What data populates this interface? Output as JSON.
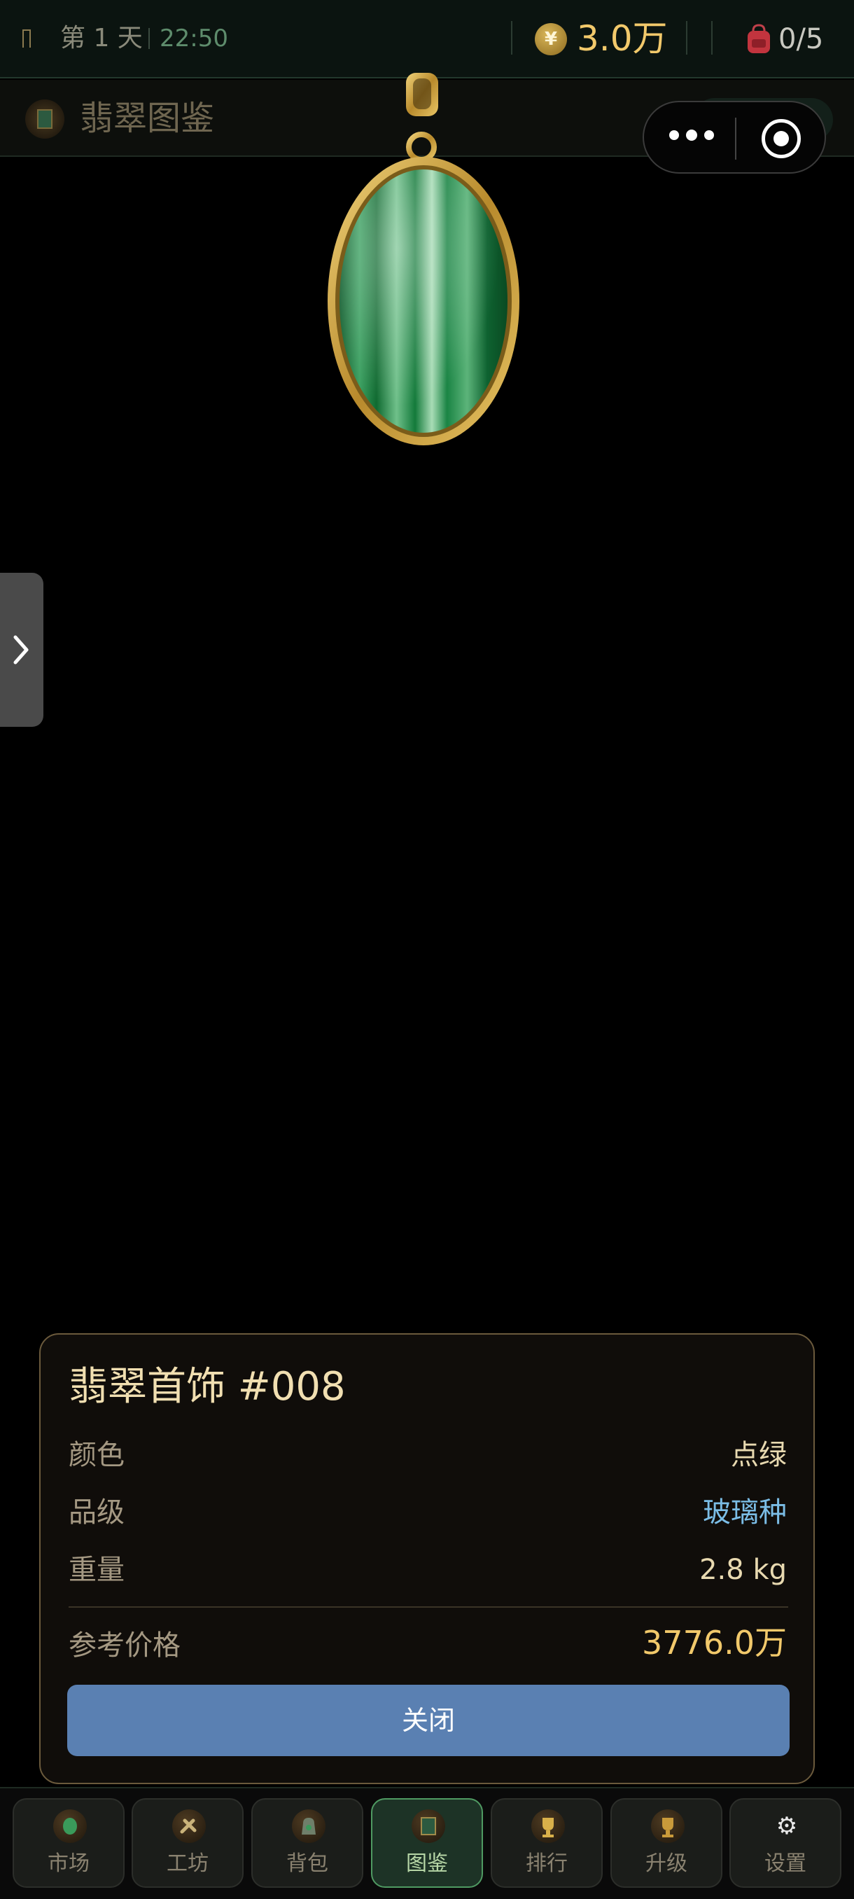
{
  "status_bar": {
    "day": "第 1 天",
    "time": "22:50",
    "coin_symbol": "¥",
    "money": "3.0万",
    "bag_count": "0/5"
  },
  "header": {
    "title": "翡翠图鉴",
    "count_text": "共 300 件"
  },
  "item": {
    "title": "翡翠首饰 #008",
    "rows": [
      {
        "label": "颜色",
        "value": "点绿"
      },
      {
        "label": "品级",
        "value": "玻璃种"
      },
      {
        "label": "重量",
        "value": "2.8 kg"
      }
    ],
    "price_label": "参考价格",
    "price_value": "3776.0万",
    "close_label": "关闭"
  },
  "nav": [
    {
      "label": "市场",
      "icon": "jade-icon"
    },
    {
      "label": "工坊",
      "icon": "tools-icon"
    },
    {
      "label": "背包",
      "icon": "bag-icon"
    },
    {
      "label": "图鉴",
      "icon": "album-icon"
    },
    {
      "label": "排行",
      "icon": "trophy-icon"
    },
    {
      "label": "升级",
      "icon": "upgrade-icon"
    },
    {
      "label": "设置",
      "icon": "gear-icon"
    }
  ],
  "colors": {
    "accent_gold": "#f2c96b",
    "grade_blue": "#7bbde6",
    "button_blue": "#5a80b2",
    "active_nav": "#4f9a62"
  }
}
